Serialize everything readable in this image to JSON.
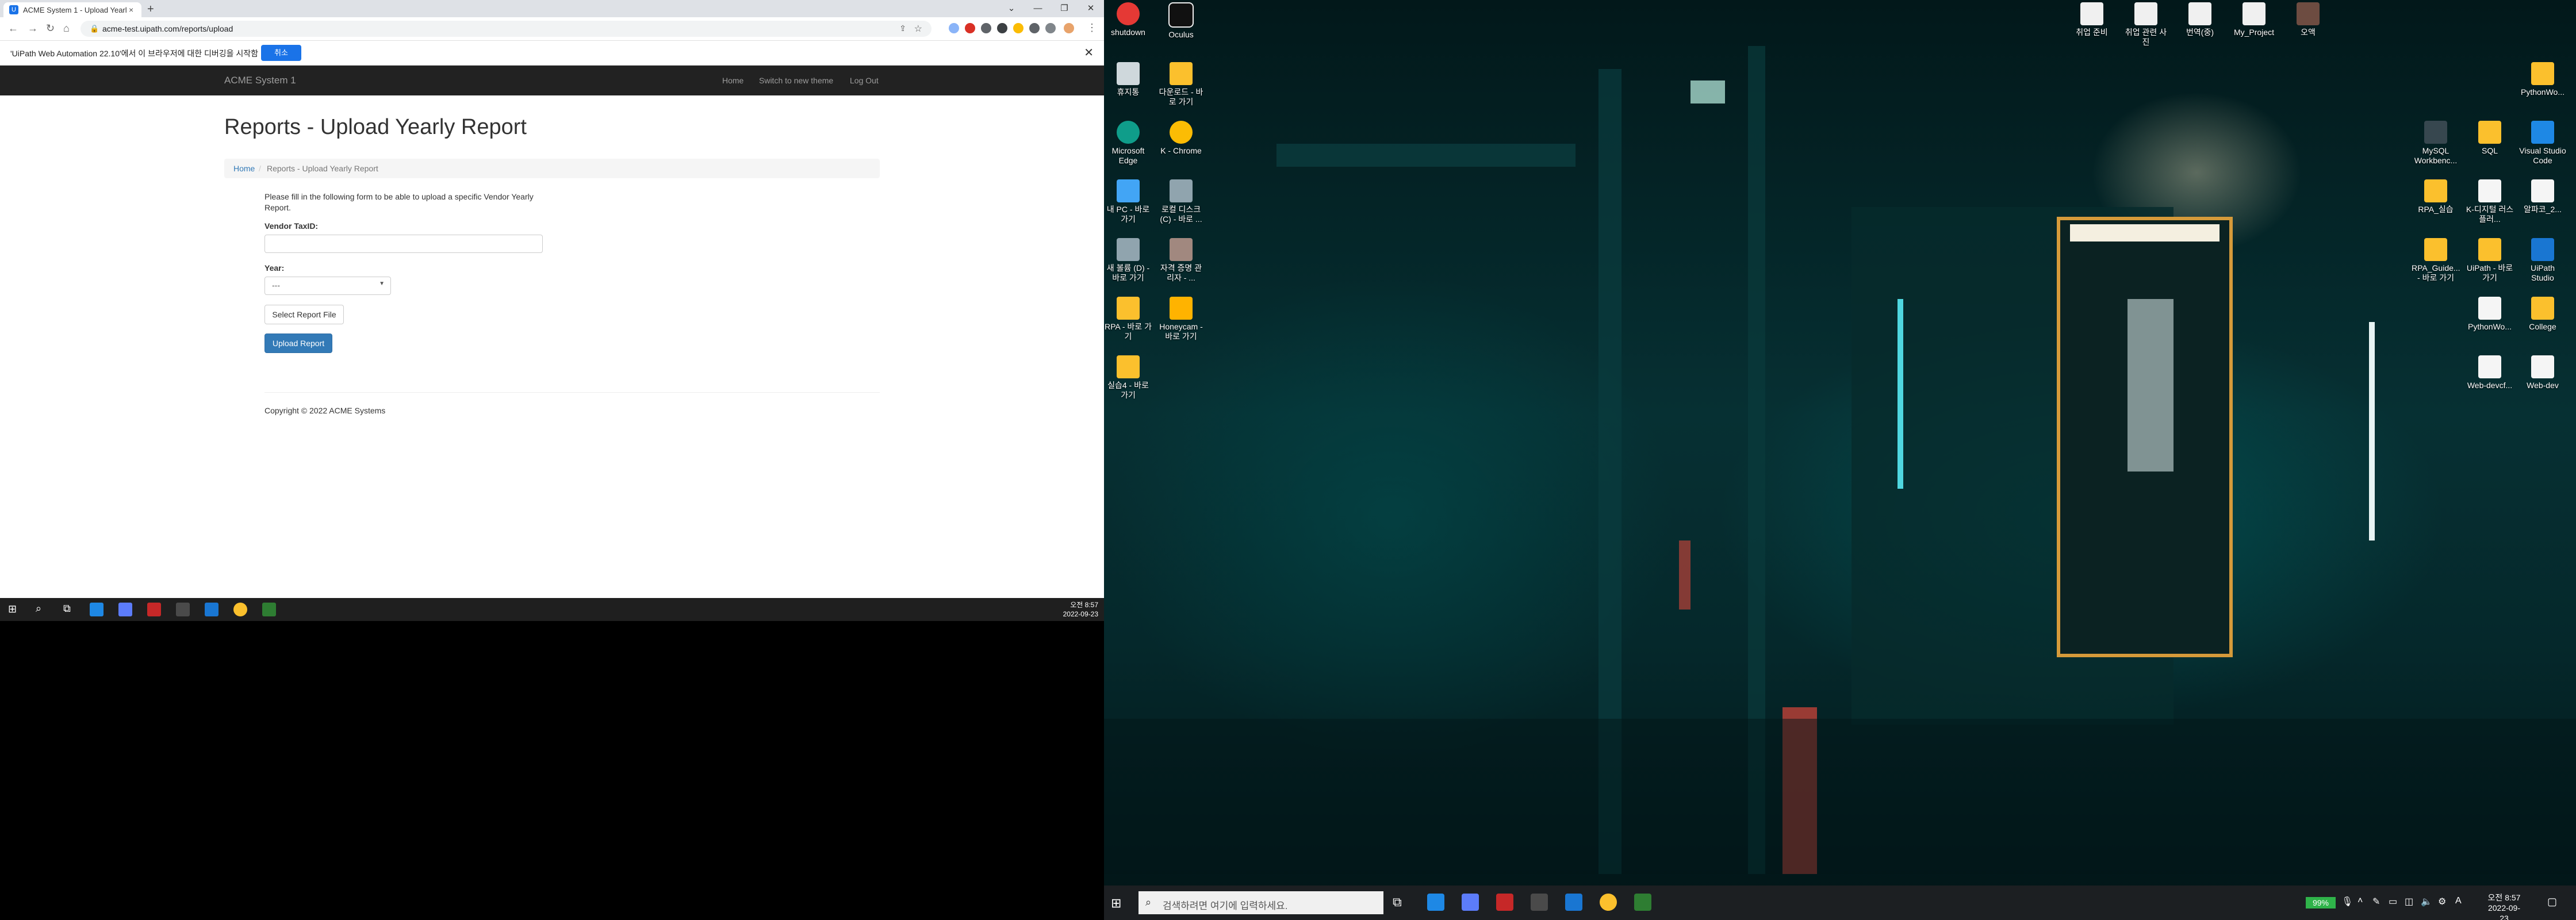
{
  "browser": {
    "tab_title": "ACME System 1 - Upload Yearly",
    "tab_close": "×",
    "new_tab": "+",
    "window_buttons": [
      "⌄",
      "—",
      "❐",
      "✕"
    ],
    "url": "acme-test.uipath.com/reports/upload",
    "infobar_message": "'UiPath Web Automation 22.10'에서 이 브라우저에 대한 디버깅을 시작함",
    "infobar_button": "취소",
    "infobar_close": "✕"
  },
  "page": {
    "brand": "ACME System 1",
    "nav": [
      "Home",
      "Switch to new theme",
      "Log Out"
    ],
    "title": "Reports - Upload Yearly Report",
    "breadcrumb": {
      "home": "Home",
      "sep": "/",
      "current": "Reports - Upload Yearly Report"
    },
    "intro": "Please fill in the following form to be able to upload a specific Vendor Yearly Report.",
    "vendor_label": "Vendor TaxID:",
    "vendor_value": "",
    "year_label": "Year:",
    "year_value": "---",
    "select_file_button": "Select Report File",
    "upload_button": "Upload Report",
    "copyright": "Copyright © 2022 ACME Systems"
  },
  "left_taskbar": {
    "time": "오전 8:57",
    "date": "2022-09-23"
  },
  "desktop": {
    "top_icons": [
      "shutdown",
      "Oculus",
      "취업 준비",
      "취업 관련 사진",
      "번역(중)",
      "My_Project",
      "오액"
    ],
    "left_icons": [
      "휴지통",
      "다운로드 - 바로 가기",
      "Microsoft Edge",
      "K - Chrome",
      "내 PC - 바로 가기",
      "로컬 디스크 (C) - 바로 ...",
      "새 볼륨 (D) - 바로 가기",
      "자격 증명 관리자 - ...",
      "RPA - 바로 가기",
      "Honeycam - 바로 가기",
      "실습4 - 바로 가기"
    ],
    "right_icons": [
      "PythonWo...",
      "MySQL Workbenc...",
      "SQL",
      "Visual Studio Code",
      "RPA_실습",
      "K-디지털 러스플러...",
      "알파코_2...",
      "RPA_Guide... - 바로 가기",
      "UiPath - 바로 가기",
      "UiPath Studio",
      "PythonWo...",
      "College",
      "Web-devcf...",
      "Web-dev"
    ]
  },
  "right_taskbar": {
    "search_placeholder": "검색하려면 여기에 입력하세요.",
    "battery": "99%",
    "ime": "A",
    "time": "오전 8:57",
    "date": "2022-09-23"
  }
}
